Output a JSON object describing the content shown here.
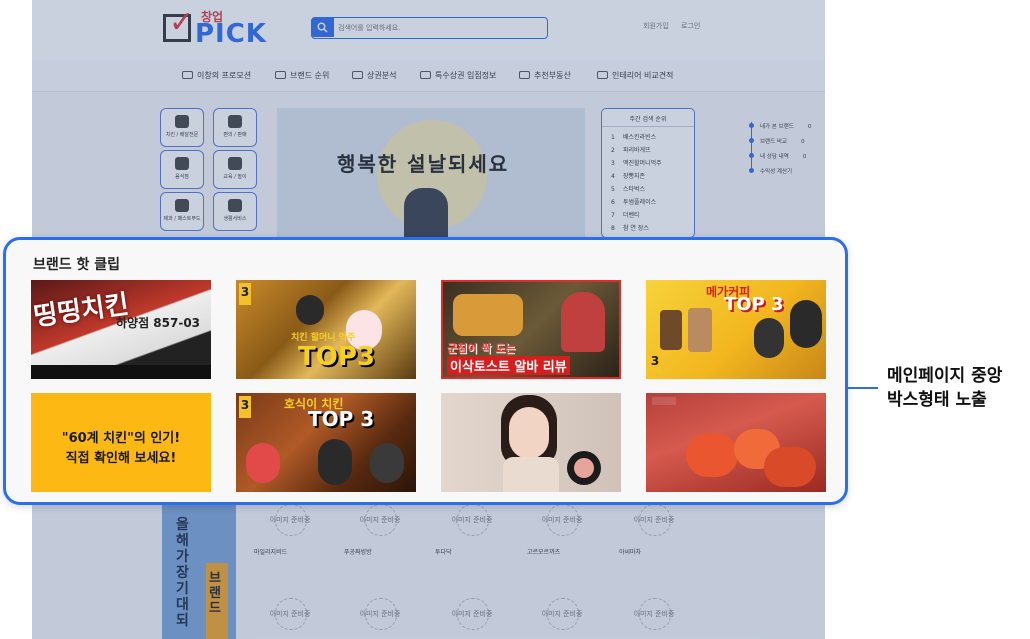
{
  "site": {
    "logo_top": "창업",
    "logo_main": "PICK",
    "search_placeholder": "검색어를 입력하세요.",
    "top_links": [
      "회원가입",
      "로그인"
    ]
  },
  "nav": [
    "이창의 프로모션",
    "브랜드 순위",
    "상권분석",
    "특수상권 입점정보",
    "추천부동산",
    "인테리어 비교견적"
  ],
  "categories": [
    {
      "label": "치킨 / 배달전문"
    },
    {
      "label": "편의 / 판매"
    },
    {
      "label": "음식점"
    },
    {
      "label": "교육 / 놀이"
    },
    {
      "label": "제과 / 패스트푸드"
    },
    {
      "label": "생활서비스"
    }
  ],
  "banner": {
    "text": "행복한 설날되세요"
  },
  "ranking": {
    "title": "주간 검색 순위",
    "items": [
      "배스킨라빈스",
      "파리바게뜨",
      "맥진할머니먹주",
      "장뽕지존",
      "스타벅스",
      "투썸플레이스",
      "더벤티",
      "참 연 장스"
    ]
  },
  "quick_menu": [
    {
      "label": "내가 본 브랜드",
      "count": "0"
    },
    {
      "label": "브랜드 비교",
      "count": "0"
    },
    {
      "label": "내 상담 내역",
      "count": "0"
    },
    {
      "label": "수익성 계산기",
      "count": ""
    }
  ],
  "lower_banner": {
    "text": "올해 가장 기대되",
    "sub": "브랜드"
  },
  "placeholder_text": "이미지 준비중",
  "lower_cards": [
    {
      "title": "마일리지비드"
    },
    {
      "title": "푸공짜빙방"
    },
    {
      "title": "투다닥"
    },
    {
      "title": "고르모르까츠"
    },
    {
      "title": "아씨마차"
    }
  ],
  "panel": {
    "title": "브랜드 핫 클립",
    "thumbnails": [
      {
        "name": "thumb-1",
        "text_main": "하양점 857-03",
        "text_sub": "띵띵치킨"
      },
      {
        "name": "thumb-2",
        "text_main": "TOP3",
        "text_sub": "치킨 할머니 먹주"
      },
      {
        "name": "thumb-3",
        "text_main": "이삭토스트 알바 리뷰",
        "text_sub": "군침이 싹 도는"
      },
      {
        "name": "thumb-4",
        "text_main": "TOP 3",
        "text_sub": "메가커피"
      },
      {
        "name": "thumb-5",
        "text_main": "\"60계 치킨\"의 인기!",
        "text_sub": "직접 확인해 보세요!"
      },
      {
        "name": "thumb-6",
        "text_main": "TOP 3",
        "text_sub": "호식이 치킨"
      },
      {
        "name": "thumb-7",
        "text_main": "",
        "text_sub": ""
      },
      {
        "name": "thumb-8",
        "text_main": "",
        "text_sub": ""
      }
    ]
  },
  "annotation": {
    "line1": "메인페이지 중앙",
    "line2": "박스형태 노출"
  },
  "colors": {
    "accent": "#2d6ef0",
    "yellow": "#fdb813",
    "red": "#e2343c"
  }
}
